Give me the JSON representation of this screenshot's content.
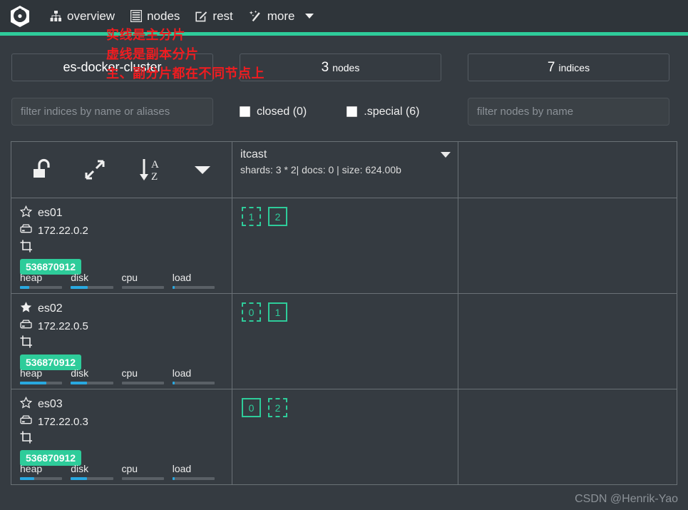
{
  "navbar": {
    "logo_icon": "cerebro-logo-icon",
    "items": [
      {
        "label": "overview",
        "icon": "sitemap-icon"
      },
      {
        "label": "nodes",
        "icon": "server-list-icon"
      },
      {
        "label": "rest",
        "icon": "edit-square-icon"
      },
      {
        "label": "more",
        "icon": "magic-wand-icon",
        "has_caret": true
      }
    ]
  },
  "summary": {
    "cluster_name": "es-docker-cluster",
    "nodes_count": "3",
    "nodes_label": "nodes",
    "indices_count": "7",
    "indices_label": "indices"
  },
  "filters": {
    "indices_placeholder": "filter indices by name or aliases",
    "indices_value": "",
    "nodes_placeholder": "filter nodes by name",
    "nodes_value": "",
    "closed_label": "closed (0)",
    "special_label": ".special (6)"
  },
  "grid_header": {
    "icons": [
      {
        "name": "unlock-icon"
      },
      {
        "name": "expand-arrows-icon"
      },
      {
        "name": "sort-alpha-down-icon"
      },
      {
        "name": "caret-down-icon"
      }
    ],
    "index": {
      "name": "itcast",
      "stats": "shards: 3 * 2| docs: 0 | size: 624.00b"
    }
  },
  "nodes": [
    {
      "name": "es01",
      "ip": "172.22.0.2",
      "master": false,
      "star_icon": "star-outline-icon",
      "server_icon": "server-icon",
      "crop_icon": "crop-icon",
      "badge": "536870912",
      "metrics": [
        {
          "label": "heap",
          "percent": 22
        },
        {
          "label": "disk",
          "percent": 40
        },
        {
          "label": "cpu",
          "percent": 0
        },
        {
          "label": "load",
          "percent": 6
        }
      ],
      "shards": [
        {
          "id": "1",
          "type": "replica"
        },
        {
          "id": "2",
          "type": "primary"
        }
      ]
    },
    {
      "name": "es02",
      "ip": "172.22.0.5",
      "master": true,
      "star_icon": "star-filled-icon",
      "server_icon": "server-icon",
      "crop_icon": "crop-icon",
      "badge": "536870912",
      "metrics": [
        {
          "label": "heap",
          "percent": 62
        },
        {
          "label": "disk",
          "percent": 38
        },
        {
          "label": "cpu",
          "percent": 0
        },
        {
          "label": "load",
          "percent": 6
        }
      ],
      "shards": [
        {
          "id": "0",
          "type": "replica"
        },
        {
          "id": "1",
          "type": "primary"
        }
      ]
    },
    {
      "name": "es03",
      "ip": "172.22.0.3",
      "master": false,
      "star_icon": "star-outline-icon",
      "server_icon": "server-icon",
      "crop_icon": "crop-icon",
      "badge": "536870912",
      "metrics": [
        {
          "label": "heap",
          "percent": 33
        },
        {
          "label": "disk",
          "percent": 38
        },
        {
          "label": "cpu",
          "percent": 0
        },
        {
          "label": "load",
          "percent": 6
        }
      ],
      "shards": [
        {
          "id": "0",
          "type": "primary"
        },
        {
          "id": "2",
          "type": "replica"
        }
      ]
    }
  ],
  "annotation": {
    "line1": "实线是主分片",
    "line2": "虚线是副本分片",
    "line3": "主、副分片都在不同节点上",
    "color": "#ef1c20"
  },
  "watermark": "CSDN @Henrik-Yao",
  "colors": {
    "accent_green": "#2ecc9a",
    "metric_blue": "#29a8e0",
    "navbar_bg": "#2f353a",
    "page_bg": "#353b41",
    "border": "#6a7176"
  }
}
